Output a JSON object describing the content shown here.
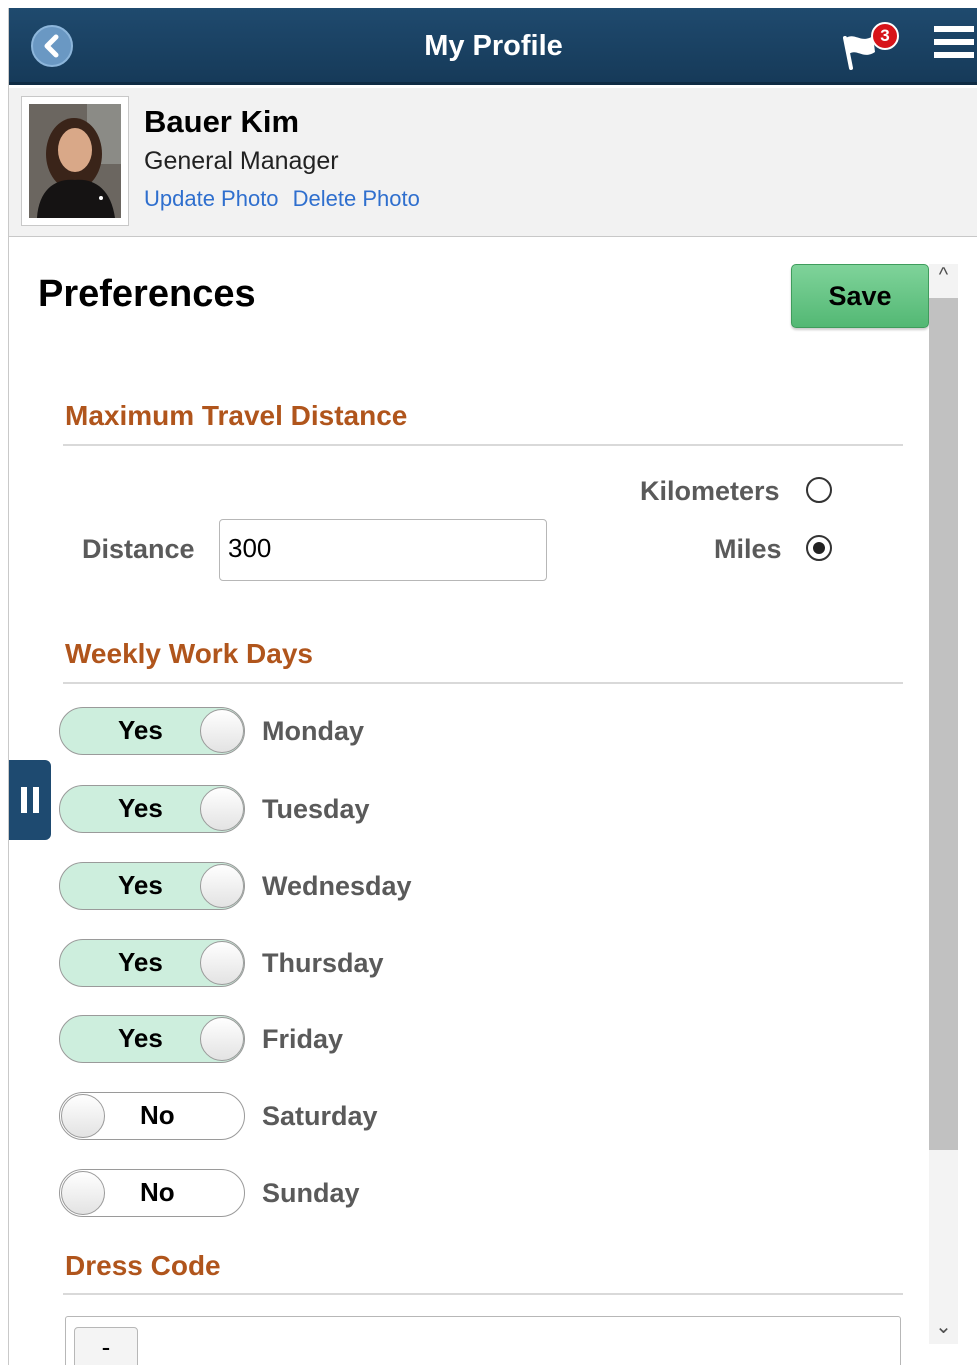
{
  "header": {
    "title": "My Profile",
    "notification_count": "3",
    "back_icon": "chevron-left-icon",
    "menu_icon": "hamburger-icon",
    "flag_icon": "flag-icon"
  },
  "profile": {
    "name": "Bauer Kim",
    "role": "General Manager",
    "update_photo": "Update Photo",
    "delete_photo": "Delete Photo"
  },
  "preferences": {
    "title": "Preferences",
    "save_label": "Save",
    "travel": {
      "heading": "Maximum Travel Distance",
      "distance_label": "Distance",
      "distance_value": "300",
      "unit_options": [
        "Kilometers",
        "Miles"
      ],
      "selected_unit": "Miles"
    },
    "work_days": {
      "heading": "Weekly Work Days",
      "days": [
        {
          "day": "Monday",
          "value": "Yes"
        },
        {
          "day": "Tuesday",
          "value": "Yes"
        },
        {
          "day": "Wednesday",
          "value": "Yes"
        },
        {
          "day": "Thursday",
          "value": "Yes"
        },
        {
          "day": "Friday",
          "value": "Yes"
        },
        {
          "day": "Saturday",
          "value": "No"
        },
        {
          "day": "Sunday",
          "value": "No"
        }
      ]
    },
    "dress_code": {
      "heading": "Dress Code",
      "button_label": "-"
    }
  },
  "colors": {
    "header_bg": "#1f4a6e",
    "section_heading": "#b0551c",
    "toggle_on": "#cdeedd",
    "save_green": "#53b874",
    "link_blue": "#2f6fce",
    "badge_red": "#d7141a"
  }
}
